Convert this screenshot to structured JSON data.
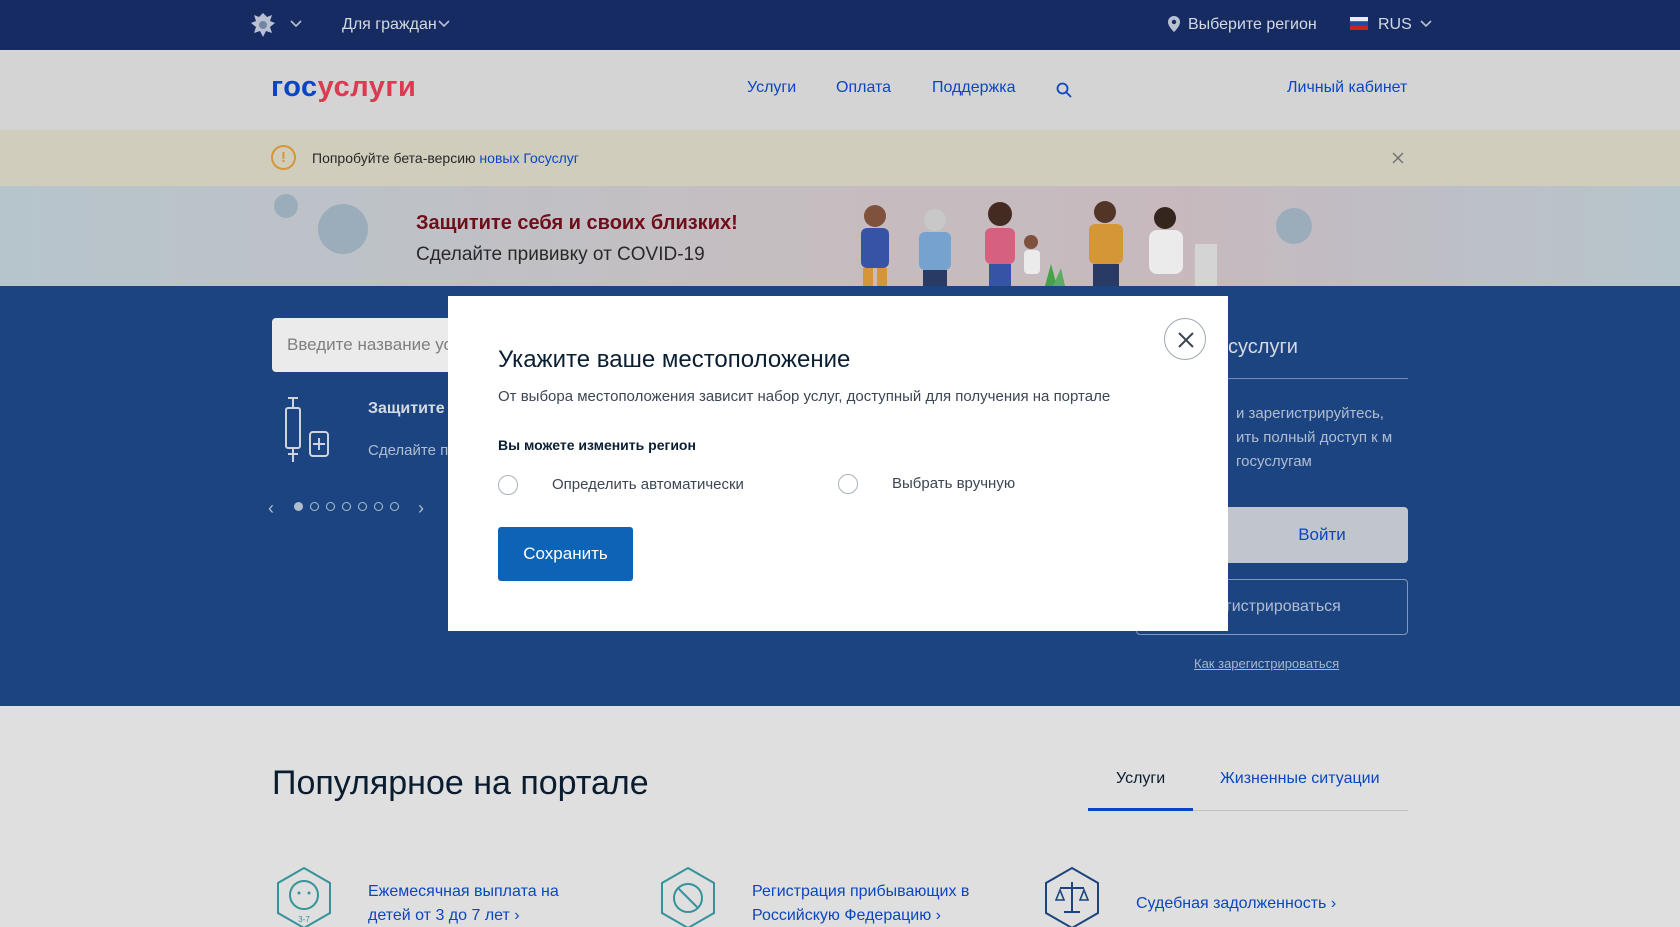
{
  "topbar": {
    "audience": "Для граждан",
    "region": "Выберите регион",
    "language": "RUS"
  },
  "header": {
    "logo_part1": "гос",
    "logo_part2": "услуги",
    "nav": [
      "Услуги",
      "Оплата",
      "Поддержка"
    ],
    "account": "Личный кабинет"
  },
  "beta": {
    "text": "Попробуйте бета-версию ",
    "link": "новых Госуслуг"
  },
  "covid_banner": {
    "headline": "Защитите себя и своих близких!",
    "subline": "Сделайте прививку от COVID-19"
  },
  "hero": {
    "search_placeholder": "Введите название ус",
    "slide_title": "Защитите",
    "slide_sub": "Сделайте пр",
    "slide_count": 7,
    "active_slide": 1
  },
  "login_panel": {
    "title": "суслуги",
    "desc": "и зарегистрируйтесь, ить полный доступ к м госуслугам",
    "login_button": "Войти",
    "register_button": "егистрироваться",
    "how_to_register": "Как зарегистрироваться"
  },
  "popular": {
    "title": "Популярное на портале",
    "tabs": [
      "Услуги",
      "Жизненные ситуации"
    ],
    "cards": [
      {
        "line1": "Ежемесячная выплата на",
        "line2": "детей от 3 до 7 лет ›",
        "icon_text": "3-7"
      },
      {
        "line1": "Регистрация прибывающих в",
        "line2": "Российскую Федерацию ›"
      },
      {
        "line1": "Судебная задолженность ›",
        "line2": ""
      }
    ]
  },
  "modal": {
    "title": "Укажите ваше местоположение",
    "description": "От выбора местоположения зависит набор услуг, доступный для получения на портале",
    "region_label": "Вы можете изменить регион",
    "options": [
      "Определить автоматически",
      "Выбрать вручную"
    ],
    "save_button": "Сохранить"
  },
  "colors": {
    "topbar": "#172f6b",
    "primary": "#0d4cd3",
    "accent_red": "#ee3f58",
    "hero_blue": "#1e4a8c",
    "save_button": "#0d63b6"
  }
}
